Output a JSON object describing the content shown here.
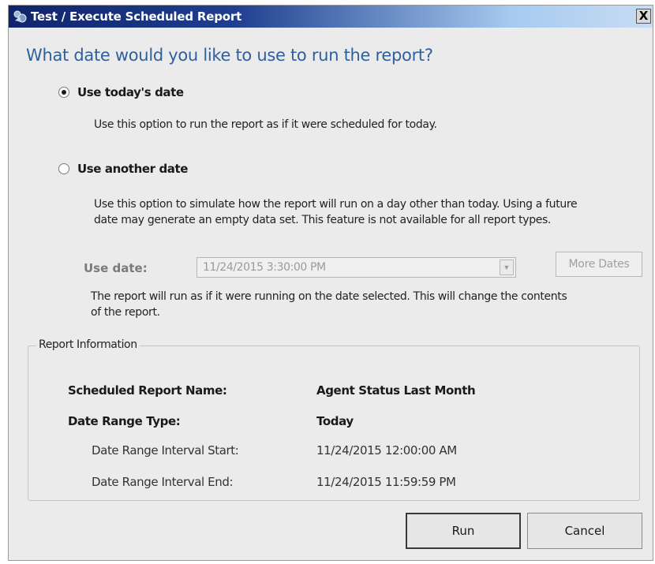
{
  "window": {
    "title": "Test / Execute Scheduled Report",
    "close_label": "X"
  },
  "heading": "What date would you like to use to run the report?",
  "options": {
    "today": {
      "label": "Use today's date",
      "selected": true,
      "description": "Use this option to run the report as if it were scheduled for today."
    },
    "another": {
      "label": "Use another date",
      "selected": false,
      "description_line1": "Use this option to simulate how the report will run on a day other than today. Using a future",
      "description_line2": "date may generate an empty data set. This feature is not available for all report types."
    }
  },
  "use_date": {
    "label": "Use date:",
    "value": "11/24/2015 3:30:00 PM",
    "more_dates_label": "More Dates",
    "note_line1": "The report will run as if it were running on the date selected. This will change the contents",
    "note_line2": "of the report."
  },
  "report_info": {
    "legend": "Report Information",
    "name_label": "Scheduled Report Name:",
    "name_value": "Agent Status Last Month",
    "range_type_label": "Date Range Type:",
    "range_type_value": "Today",
    "start_label": "Date Range Interval Start:",
    "start_value": "11/24/2015 12:00:00 AM",
    "end_label": "Date Range Interval End:",
    "end_value": "11/24/2015 11:59:59 PM"
  },
  "buttons": {
    "run": "Run",
    "cancel": "Cancel"
  },
  "icons": {
    "app": "report-app-icon",
    "close": "close-icon",
    "dropdown": "chevron-down-icon"
  }
}
